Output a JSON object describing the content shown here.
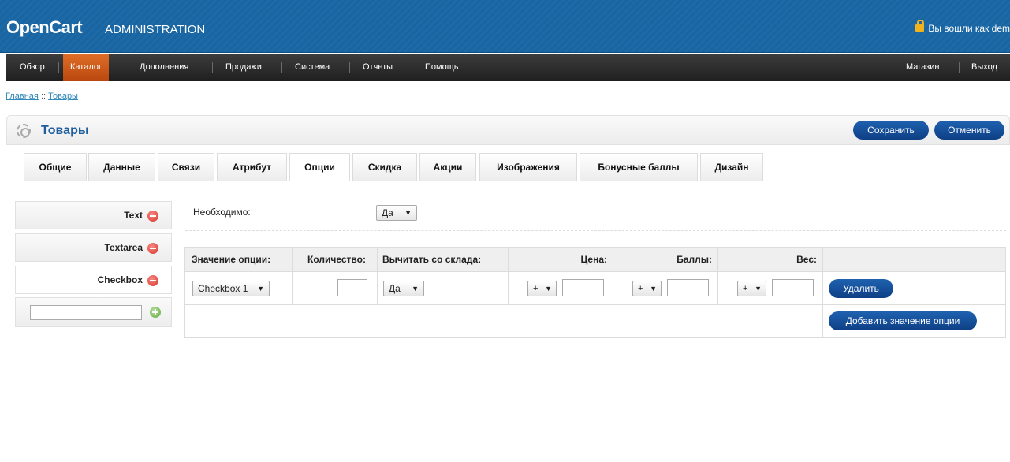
{
  "header": {
    "logo": "OpenCart",
    "logo_subtitle": "ADMINISTRATION",
    "login_text": "Вы вошли как dem"
  },
  "menu": {
    "items": [
      "Обзор",
      "Каталог",
      "Дополнения",
      "Продажи",
      "Система",
      "Отчеты",
      "Помощь"
    ],
    "active": "Каталог",
    "right_items": [
      "Магазин",
      "Выход"
    ]
  },
  "breadcrumb": {
    "home": "Главная",
    "separator": "::",
    "current": "Товары"
  },
  "box": {
    "title": "Товары",
    "save_label": "Сохранить",
    "cancel_label": "Отменить"
  },
  "tabs": [
    "Общие",
    "Данные",
    "Связи",
    "Атрибут",
    "Опции",
    "Скидка",
    "Акции",
    "Изображения",
    "Бонусные баллы",
    "Дизайн"
  ],
  "active_tab": "Опции",
  "option_tabs": [
    "Text",
    "Textarea",
    "Checkbox"
  ],
  "active_option_tab": "Checkbox",
  "new_option_input": {
    "value": ""
  },
  "required": {
    "label": "Необходимо:",
    "value": "Да"
  },
  "option_table": {
    "headers": {
      "option_value": "Значение опции:",
      "quantity": "Количество:",
      "subtract": "Вычитать со склада:",
      "price": "Цена:",
      "points": "Баллы:",
      "weight": "Вес:"
    },
    "row": {
      "option_value": "Checkbox 1",
      "quantity": "",
      "subtract": "Да",
      "price_prefix": "+",
      "price": "",
      "points_prefix": "+",
      "points": "",
      "weight_prefix": "+",
      "weight": "",
      "remove_label": "Удалить"
    },
    "add_label": "Добавить значение опции"
  },
  "colors": {
    "header_blue": "#1c6aa8",
    "menu_active": "#d35a1a",
    "button_blue": "#0e3f85",
    "title_blue": "#1e5fa0"
  }
}
